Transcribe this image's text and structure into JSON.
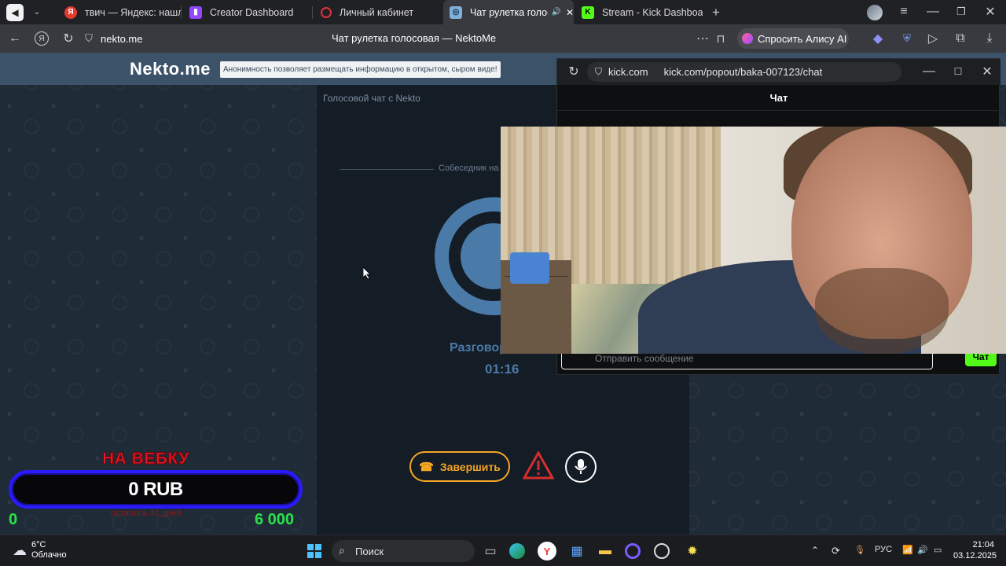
{
  "tabs": [
    {
      "label": "твич — Яндекс: нашлось",
      "icon": "yandex-icon"
    },
    {
      "label": "Creator Dashboard",
      "icon": "twitch-icon"
    },
    {
      "label": "Личный кабинет",
      "icon": "opera-icon"
    },
    {
      "label": "Чат рулетка голосо",
      "icon": "nekto-icon",
      "active": true
    },
    {
      "label": "Stream - Kick Dashboard",
      "icon": "kick-icon"
    }
  ],
  "address": {
    "url": "nekto.me",
    "page_title": "Чат рулетка голосовая — NektoMe",
    "alice_label": "Спросить Алису AI"
  },
  "site": {
    "logo": "Nekto.me",
    "slogan": "Анонимность позволяет размещать информацию в открытом, сыром виде!",
    "voice_chat_label": "Голосовой чат с Nekto",
    "partner_label": "Собеседник на",
    "talk_label": "Разговор",
    "timer": "01:16",
    "end_button": "Завершить"
  },
  "popup": {
    "domain": "kick.com",
    "path": "kick.com/popout/baka-007123/chat",
    "chat_title": "Чат",
    "message_placeholder": "Отправить сообщение",
    "send_label": "Чат"
  },
  "overlay": {
    "title": "НА ВЕБКУ",
    "amount": "0 RUB",
    "left": "0",
    "right": "6 000",
    "sub": "осталось 31 дней"
  },
  "taskbar": {
    "temp": "6°C",
    "weather": "Облачно",
    "search": "Поиск",
    "lang": "РУС",
    "time": "21:04",
    "date": "03.12.2025"
  },
  "colors": {
    "accent": "#4a7aa8",
    "end_button": "#f5a623",
    "kick_green": "#53fc18",
    "overlay_red": "#e8192c",
    "overlay_blue": "#2a1bff",
    "overlay_green": "#29e34a"
  }
}
